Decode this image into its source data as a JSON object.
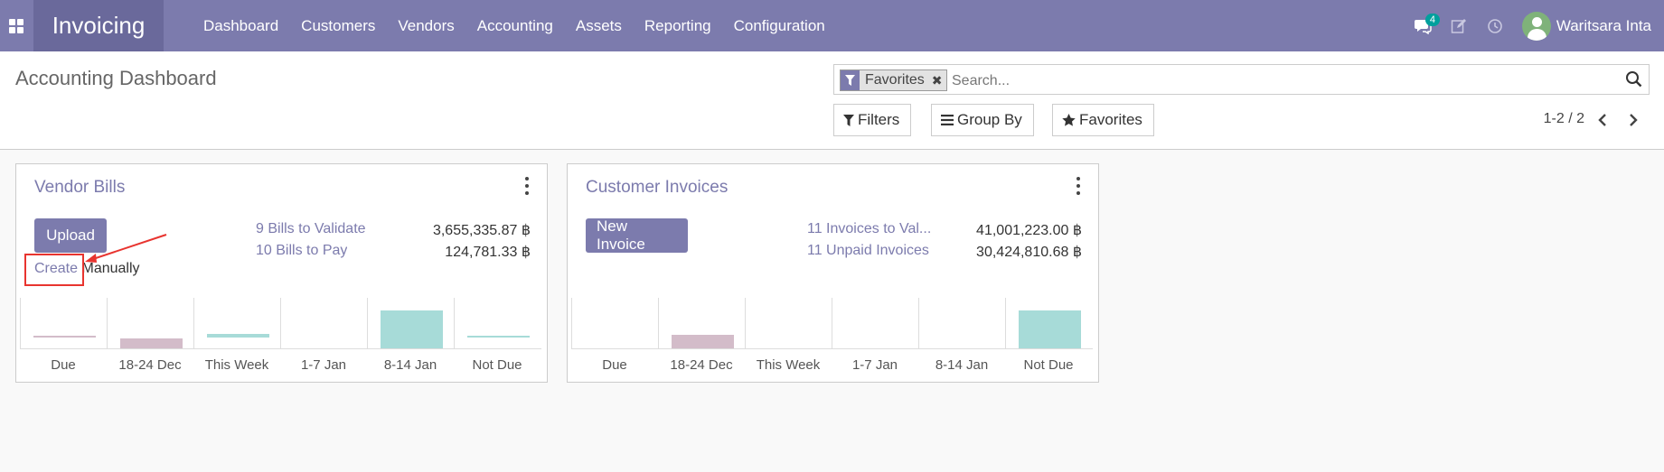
{
  "navbar": {
    "app_name": "Invoicing",
    "menu": [
      "Dashboard",
      "Customers",
      "Vendors",
      "Accounting",
      "Assets",
      "Reporting",
      "Configuration"
    ],
    "messages_count": "4",
    "user_name": "Waritsara Inta",
    "icons": [
      "apps-icon",
      "chat-icon",
      "activity-edit-icon",
      "clock-icon"
    ],
    "color": "#7c7bad"
  },
  "control_panel": {
    "title": "Accounting Dashboard",
    "facet_label": "Favorites",
    "search_placeholder": "Search...",
    "filters_label": "Filters",
    "groupby_label": "Group By",
    "favorites_label": "Favorites",
    "pager": "1-2 / 2"
  },
  "cards": [
    {
      "title": "Vendor Bills",
      "primary_button": "Upload",
      "secondary_link": "Create",
      "secondary_text": "Manually",
      "stats": [
        {
          "label": "9 Bills to Validate",
          "value": "3,655,335.87 ฿"
        },
        {
          "label": "10 Bills to Pay",
          "value": "124,781.33 ฿"
        }
      ],
      "chart_data": {
        "type": "bar",
        "categories": [
          "Due",
          "18-24 Dec",
          "This Week",
          "1-7 Jan",
          "8-14 Jan",
          "Not Due"
        ],
        "values": [
          0.05,
          0.25,
          0.1,
          0,
          1.0,
          0.03
        ]
      }
    },
    {
      "title": "Customer Invoices",
      "primary_button": "New Invoice",
      "stats": [
        {
          "label": "11 Invoices to Val...",
          "value": "41,001,223.00 ฿"
        },
        {
          "label": "11 Unpaid Invoices",
          "value": "30,424,810.68 ฿"
        }
      ],
      "chart_data": {
        "type": "bar",
        "categories": [
          "Due",
          "18-24 Dec",
          "This Week",
          "1-7 Jan",
          "8-14 Jan",
          "Not Due"
        ],
        "values": [
          0,
          0.35,
          0,
          0,
          0,
          1.0
        ]
      }
    }
  ],
  "colors": {
    "past_bar": "#d3bcc9",
    "future_bar": "#a7dbd8",
    "annotation": "#e8342f"
  }
}
